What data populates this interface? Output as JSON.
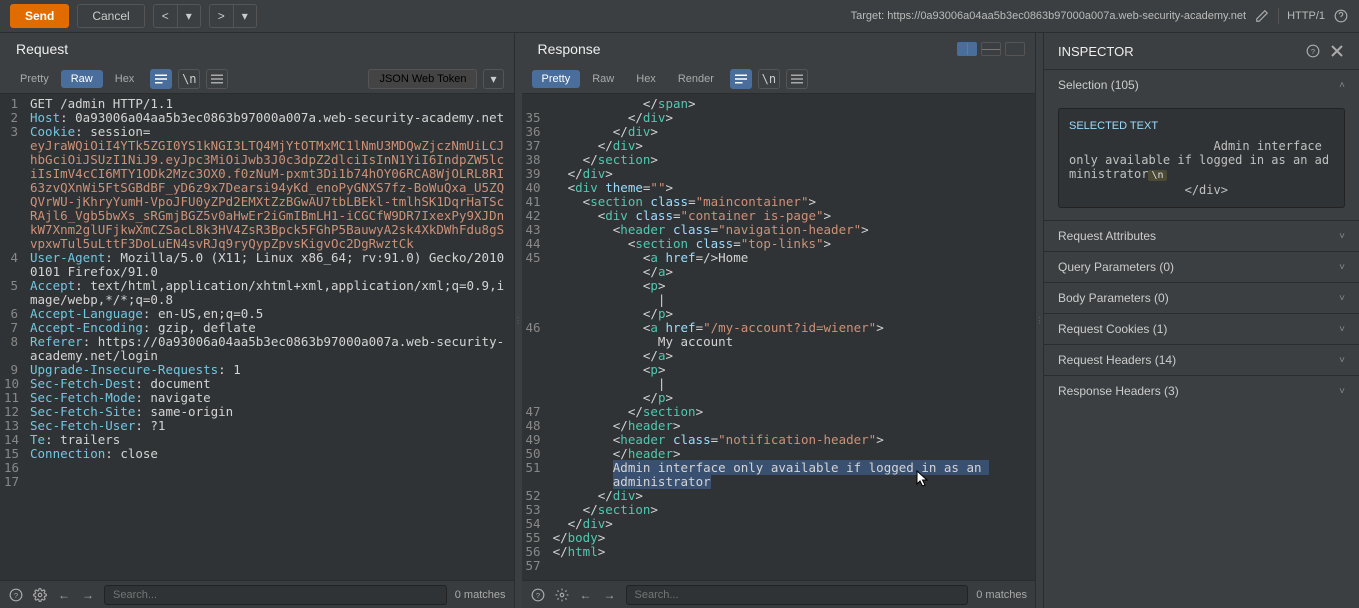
{
  "toolbar": {
    "send": "Send",
    "cancel": "Cancel",
    "target_prefix": "Target: ",
    "target_url": "https://0a93006a04aa5b3ec0863b97000a007a.web-security-academy.net",
    "http_label": "HTTP/1"
  },
  "panels": {
    "request_title": "Request",
    "response_title": "Response"
  },
  "tabs": {
    "pretty": "Pretty",
    "raw": "Raw",
    "hex": "Hex",
    "render": "Render",
    "json_token": "JSON Web Token"
  },
  "request_lines": [
    {
      "n": "1",
      "html": "<span class='h-method'>GET /admin HTTP/1.1</span>"
    },
    {
      "n": "2",
      "html": "<span class='h-key'>Host</span>: 0a93006a04aa5b3ec0863b97000a007a.web-security-academy.net"
    },
    {
      "n": "3",
      "html": "<span class='h-key'>Cookie</span>: session=<br><span class='h-cookie'>eyJraWQiOiI4YTk5ZGI0YS1kNGI3LTQ4MjYtOTMxMC1lNmU3MDQwZjczNmUiLCJhbGciOiJSUzI1NiJ9.eyJpc3MiOiJwb3J0c3dpZ2dlciIsInN1YiI6IndpZW5lciIsImV4cCI6MTY1ODk2Mzc3OX0.f0zNuM-pxmt3Di1b74hOY06RCA8WjOLRL8RI63zvQXnWi5FtSGBdBF_yD6z9x7Dearsi94yKd_enoPyGNXS7fz-BoWuQxa_U5ZQQVrWU-jKhryYumH-VpoJFU0yZPd2EMXtZzBGwAU7tbLBEkl-tmlhSK1DqrHaTScRAjl6_Vgb5bwXs_sRGmjBGZ5v0aHwEr2iGmIBmLH1-iCGCfW9DR7IxexPy9XJDnkW7Xnm2glUFjkwXmCZSacL8k3HV4ZsR3Bpck5FGhP5BauwyA2sk4XkDWhFdu8gSvpxwTul5uLttF3DoLuEN4svRJq9ryQypZpvsKigvOc2DgRwztCk</span>",
      "wrap": true
    },
    {
      "n": "4",
      "html": "<span class='h-key'>User-Agent</span>: Mozilla/5.0 (X11; Linux x86_64; rv:91.0) Gecko/20100101 Firefox/91.0",
      "wrap": true
    },
    {
      "n": "5",
      "html": "<span class='h-key'>Accept</span>: text/html,application/xhtml+xml,application/xml;q=0.9,image/webp,*/*;q=0.8",
      "wrap": true
    },
    {
      "n": "6",
      "html": "<span class='h-key'>Accept-Language</span>: en-US,en;q=0.5"
    },
    {
      "n": "7",
      "html": "<span class='h-key'>Accept-Encoding</span>: gzip, deflate"
    },
    {
      "n": "8",
      "html": "<span class='h-key'>Referer</span>: https://0a93006a04aa5b3ec0863b97000a007a.web-security-academy.net/login",
      "wrap": true
    },
    {
      "n": "9",
      "html": "<span class='h-key'>Upgrade-Insecure-Requests</span>: 1"
    },
    {
      "n": "10",
      "html": "<span class='h-key'>Sec-Fetch-Dest</span>: document"
    },
    {
      "n": "11",
      "html": "<span class='h-key'>Sec-Fetch-Mode</span>: navigate"
    },
    {
      "n": "12",
      "html": "<span class='h-key'>Sec-Fetch-Site</span>: same-origin"
    },
    {
      "n": "13",
      "html": "<span class='h-key'>Sec-Fetch-User</span>: ?1"
    },
    {
      "n": "14",
      "html": "<span class='h-key'>Te</span>: trailers"
    },
    {
      "n": "15",
      "html": "<span class='h-key'>Connection</span>: close"
    },
    {
      "n": "16",
      "html": ""
    },
    {
      "n": "17",
      "html": ""
    }
  ],
  "response_lines": [
    {
      "n": "",
      "html": "            &lt;/<span class='h-tag'>span</span>&gt;"
    },
    {
      "n": "35",
      "html": "          &lt;/<span class='h-tag'>div</span>&gt;"
    },
    {
      "n": "36",
      "html": "        &lt;/<span class='h-tag'>div</span>&gt;"
    },
    {
      "n": "37",
      "html": "      &lt;/<span class='h-tag'>div</span>&gt;"
    },
    {
      "n": "38",
      "html": "    &lt;/<span class='h-tag'>section</span>&gt;"
    },
    {
      "n": "39",
      "html": "  &lt;/<span class='h-tag'>div</span>&gt;"
    },
    {
      "n": "40",
      "html": "  &lt;<span class='h-tag'>div</span> <span class='h-attr'>theme</span>=<span class='h-str'>\"\"</span>&gt;"
    },
    {
      "n": "41",
      "html": "    &lt;<span class='h-tag'>section</span> <span class='h-attr'>class</span>=<span class='h-str'>\"maincontainer\"</span>&gt;"
    },
    {
      "n": "42",
      "html": "      &lt;<span class='h-tag'>div</span> <span class='h-attr'>class</span>=<span class='h-str'>\"container is-page\"</span>&gt;"
    },
    {
      "n": "43",
      "html": "        &lt;<span class='h-tag'>header</span> <span class='h-attr'>class</span>=<span class='h-str'>\"navigation-header\"</span>&gt;"
    },
    {
      "n": "44",
      "html": "          &lt;<span class='h-tag'>section</span> <span class='h-attr'>class</span>=<span class='h-str'>\"top-links\"</span>&gt;"
    },
    {
      "n": "45",
      "html": "            &lt;<span class='h-tag'>a</span> <span class='h-attr'>href</span>=/&gt;Home<br>            &lt;/<span class='h-tag'>a</span>&gt;<br>            &lt;<span class='h-tag'>p</span>&gt;<br>              |<br>            &lt;/<span class='h-tag'>p</span>&gt;",
      "wrap": true
    },
    {
      "n": "46",
      "html": "            &lt;<span class='h-tag'>a</span> <span class='h-attr'>href</span>=<span class='h-str'>\"/my-account?id=wiener\"</span>&gt;<br>              My account<br>            &lt;/<span class='h-tag'>a</span>&gt;<br>            &lt;<span class='h-tag'>p</span>&gt;<br>              |<br>            &lt;/<span class='h-tag'>p</span>&gt;",
      "wrap": true
    },
    {
      "n": "47",
      "html": "          &lt;/<span class='h-tag'>section</span>&gt;"
    },
    {
      "n": "48",
      "html": "        &lt;/<span class='h-tag'>header</span>&gt;"
    },
    {
      "n": "49",
      "html": "        &lt;<span class='h-tag'>header</span> <span class='h-attr'>class</span>=<span class='h-str'>\"notification-header\"</span>&gt;"
    },
    {
      "n": "50",
      "html": "        &lt;/<span class='h-tag'>header</span>&gt;"
    },
    {
      "n": "51",
      "html": "        <span class='sel'>Admin interface only available if logged in as an </span><br>        <span class='sel'>administrator</span>",
      "wrap": true
    },
    {
      "n": "52",
      "html": "      &lt;/<span class='h-tag'>div</span>&gt;"
    },
    {
      "n": "53",
      "html": "    &lt;/<span class='h-tag'>section</span>&gt;"
    },
    {
      "n": "54",
      "html": "  &lt;/<span class='h-tag'>div</span>&gt;"
    },
    {
      "n": "55",
      "html": "&lt;/<span class='h-tag'>body</span>&gt;"
    },
    {
      "n": "56",
      "html": "&lt;/<span class='h-tag'>html</span>&gt;"
    },
    {
      "n": "57",
      "html": ""
    }
  ],
  "search": {
    "placeholder": "Search...",
    "matches": "0 matches"
  },
  "inspector": {
    "title": "INSPECTOR",
    "selection_hdr": "Selection (105)",
    "selected_label": "SELECTED TEXT",
    "selected_text": "                    Admin interface only available if logged in as an administrator",
    "selected_suffix": "                </div>",
    "sections": [
      {
        "label": "Request Attributes"
      },
      {
        "label": "Query Parameters (0)"
      },
      {
        "label": "Body Parameters (0)"
      },
      {
        "label": "Request Cookies (1)"
      },
      {
        "label": "Request Headers (14)"
      },
      {
        "label": "Response Headers (3)"
      }
    ]
  }
}
